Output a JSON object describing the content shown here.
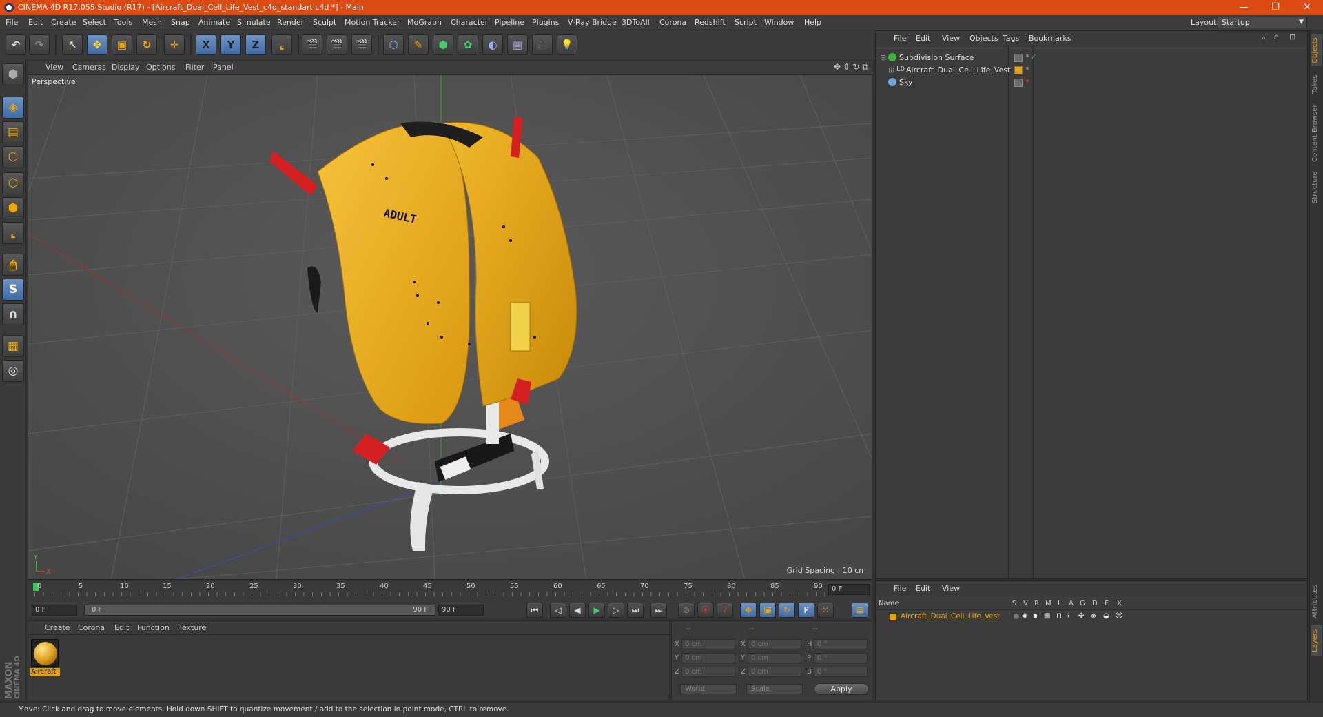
{
  "app": {
    "title": "CINEMA 4D R17.055 Studio (R17) - [Aircraft_Dual_Cell_Life_Vest_c4d_standart.c4d *] - Main"
  },
  "window_controls": {
    "minimize": "—",
    "restore": "❐",
    "close": "✕"
  },
  "menu": [
    "File",
    "Edit",
    "Create",
    "Select",
    "Tools",
    "Mesh",
    "Snap",
    "Animate",
    "Simulate",
    "Render",
    "Sculpt",
    "Motion Tracker",
    "MoGraph",
    "Character",
    "Pipeline",
    "Plugins",
    "V-Ray Bridge",
    "3DToAll",
    "Corona",
    "Redshift",
    "Script",
    "Window",
    "Help"
  ],
  "layout": {
    "label": "Layout:",
    "value": "Startup"
  },
  "toolbar": {
    "undo": "↶",
    "redo": "↷",
    "select": "↖",
    "move": "✥",
    "scale": "▣",
    "rotate": "↻",
    "move2": "✛",
    "axis_x": "X",
    "axis_y": "Y",
    "axis_z": "Z",
    "coord": "⌞",
    "render1": "🎬",
    "render2": "🎬",
    "render3": "🎬",
    "cube": "⬡",
    "pen": "✎",
    "nurbs": "⬢",
    "array": "✿",
    "deformer": "◐",
    "floor": "▦",
    "camera": "🎥",
    "light": "💡"
  },
  "left_tools": [
    "⬢",
    "◈",
    "▤",
    "⬡",
    "⬡",
    "⬢",
    "⌞",
    "🖱",
    "S",
    "∩",
    "▦",
    "◎"
  ],
  "viewport": {
    "menu": [
      "View",
      "Cameras",
      "Display",
      "Options",
      "Filter",
      "Panel"
    ],
    "nav_icons": "✥ ⇕ ↻ ⧉",
    "label": "Perspective",
    "grid_spacing": "Grid Spacing : 10 cm",
    "axis_y": "Y",
    "axis_x": "X",
    "vest_text": "ADULT"
  },
  "timeline": {
    "ticks": [
      "0",
      "5",
      "10",
      "15",
      "20",
      "25",
      "30",
      "35",
      "40",
      "45",
      "50",
      "55",
      "60",
      "65",
      "70",
      "75",
      "80",
      "85",
      "90"
    ],
    "current_frame": "0 F",
    "start": "0 F",
    "range_start": "0 F",
    "range_end": "90 F",
    "end": "90 F"
  },
  "transport": [
    "⏮",
    "◁",
    "◀",
    "▶",
    "▷",
    "⏭",
    "⏭"
  ],
  "transport_right": [
    "⊘",
    "⦿",
    "?",
    "✥",
    "▣",
    "↻",
    "P",
    "⁙",
    "▤"
  ],
  "materials": {
    "menu": [
      "Create",
      "Corona",
      "Edit",
      "Function",
      "Texture"
    ],
    "items": [
      {
        "name": "Aircraft"
      }
    ]
  },
  "coordinates": {
    "headers": [
      "--",
      "--",
      "--"
    ],
    "rows": [
      {
        "a": "X",
        "av": "0 cm",
        "b": "X",
        "bv": "0 cm",
        "c": "H",
        "cv": "0 °"
      },
      {
        "a": "Y",
        "av": "0 cm",
        "b": "Y",
        "bv": "0 cm",
        "c": "P",
        "cv": "0 °"
      },
      {
        "a": "Z",
        "av": "0 cm",
        "b": "Z",
        "bv": "0 cm",
        "c": "B",
        "cv": "0 °"
      }
    ],
    "world": "World",
    "scale": "Scale",
    "apply": "Apply"
  },
  "objects": {
    "menu": [
      "File",
      "Edit",
      "View",
      "Objects",
      "Tags",
      "Bookmarks"
    ],
    "items": [
      {
        "name": "Subdivision Surface",
        "color": "#3db53d"
      },
      {
        "name": "Aircraft_Dual_Cell_Life_Vest",
        "color": "#aaaaaa"
      },
      {
        "name": "Sky",
        "color": "#6fa7d8"
      }
    ]
  },
  "layers": {
    "menu": [
      "File",
      "Edit",
      "View"
    ],
    "headers": [
      "Name",
      "S",
      "V",
      "R",
      "M",
      "L",
      "A",
      "G",
      "D",
      "E",
      "X"
    ],
    "rows": [
      {
        "name": "Aircraft_Dual_Cell_Life_Vest",
        "color": "#e8a000"
      }
    ]
  },
  "right_tabs": [
    "Objects",
    "Takes",
    "Content Browser",
    "Structure",
    "Attributes",
    "Layers"
  ],
  "brand": {
    "line1": "MAXON",
    "line2": "CINEMA 4D"
  },
  "status": "Move: Click and drag to move elements. Hold down SHIFT to quantize movement / add to the selection in point mode, CTRL to remove."
}
